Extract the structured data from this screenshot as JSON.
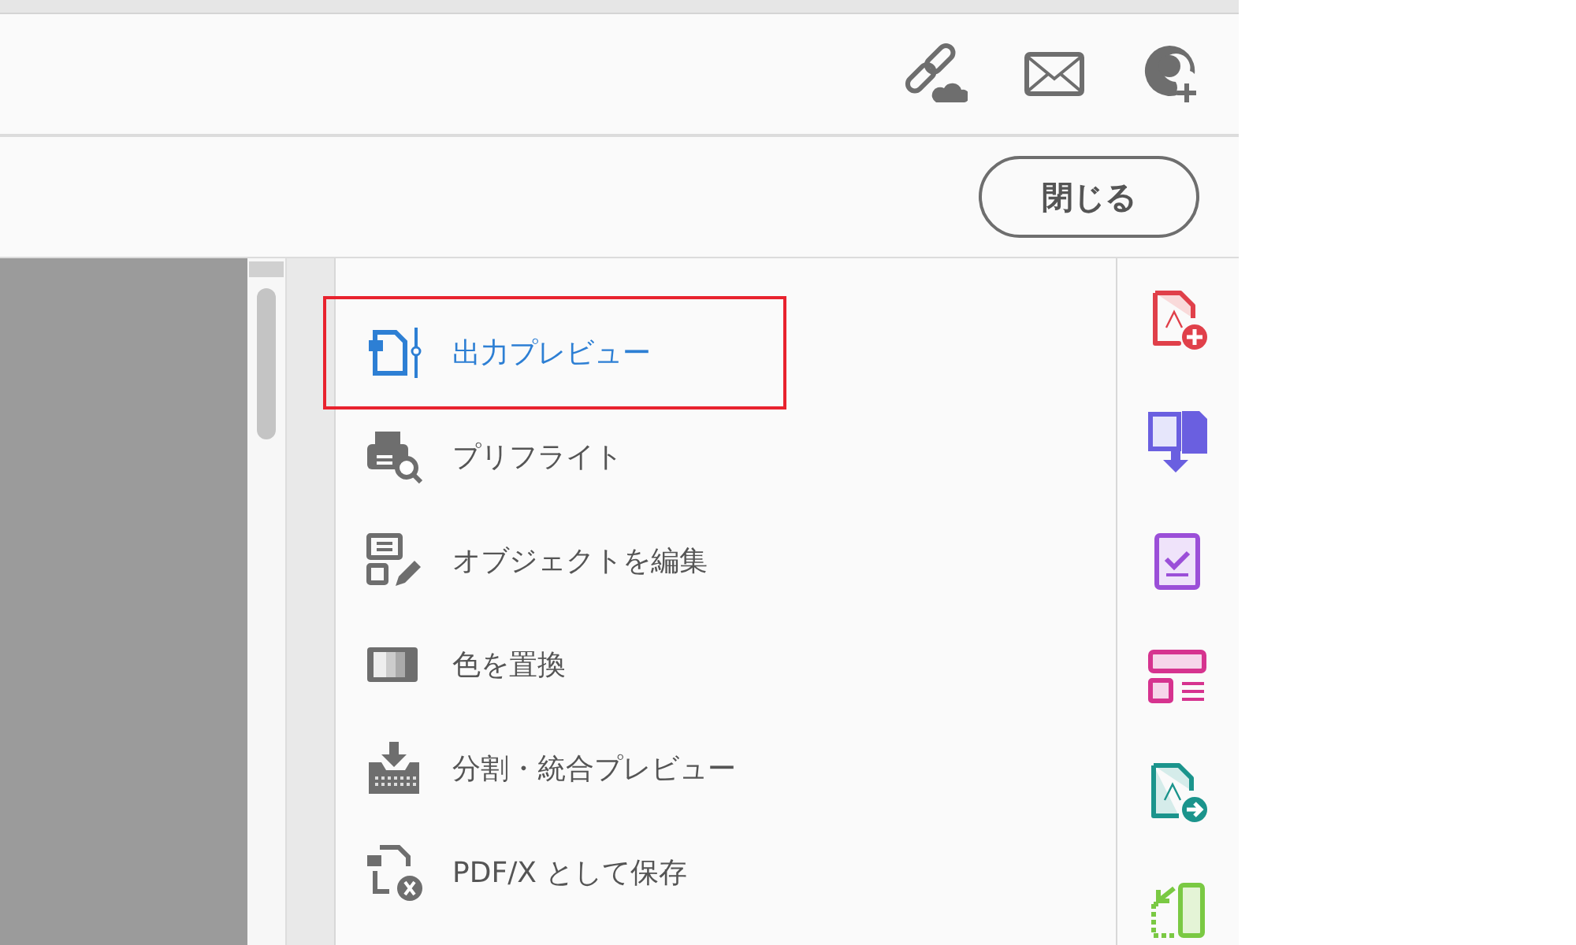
{
  "close_button": {
    "label": "閉じる"
  },
  "tools": [
    {
      "kind": "output-preview",
      "label": "出力プレビュー",
      "selected": true
    },
    {
      "kind": "preflight",
      "label": "プリフライト",
      "selected": false
    },
    {
      "kind": "edit-object",
      "label": "オブジェクトを編集",
      "selected": false
    },
    {
      "kind": "replace-color",
      "label": "色を置換",
      "selected": false
    },
    {
      "kind": "flatten",
      "label": "分割・統合プレビュー",
      "selected": false
    },
    {
      "kind": "pdfx",
      "label": "PDF/X として保存",
      "selected": false
    }
  ],
  "rail": [
    {
      "kind": "create"
    },
    {
      "kind": "combine"
    },
    {
      "kind": "check"
    },
    {
      "kind": "layout"
    },
    {
      "kind": "export"
    },
    {
      "kind": "organize"
    }
  ]
}
